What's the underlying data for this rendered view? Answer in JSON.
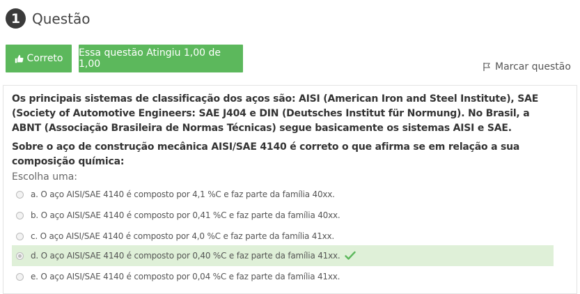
{
  "question": {
    "number": "1",
    "title": "Questão",
    "status_label": "Correto",
    "score_label": "Essa questão Atingiu 1,00 de 1,00",
    "flag_label": "Marcar questão",
    "text_paragraph_1": "Os principais sistemas de classificação dos aços são: AISI (American Iron and Steel Institute), SAE (Society of Automotive Engineers: SAE J404 e DIN (Deutsches Institut für Normung). No Brasil, a ABNT (Associação Brasileira de Normas Técnicas) segue basicamente os sistemas AISI e SAE.",
    "text_paragraph_2": "Sobre o aço de construção mecânica AISI/SAE 4140 é correto o que afirma se em relação a sua composição química:",
    "choose_label": "Escolha uma:",
    "options": [
      {
        "label": "a. O aço AISI/SAE 4140 é composto por 4,1 %C e faz parte da família 40xx.",
        "selected": false
      },
      {
        "label": "b. O aço AISI/SAE 4140 é composto por 0,41 %C e faz parte da família 40xx.",
        "selected": false
      },
      {
        "label": "c. O aço AISI/SAE 4140 é composto por 4,0 %C e faz parte da família 41xx.",
        "selected": false
      },
      {
        "label": "d. O aço AISI/SAE 4140 é composto por 0,40 %C e faz parte da família 41xx.",
        "selected": true
      },
      {
        "label": "e. O aço AISI/SAE 4140 é composto por 0,04 %C e faz parte da família 41xx.",
        "selected": false
      }
    ]
  },
  "colors": {
    "success": "#5cb85c",
    "selected_bg": "#dff0d8",
    "number_bg": "#3a3a3a"
  }
}
